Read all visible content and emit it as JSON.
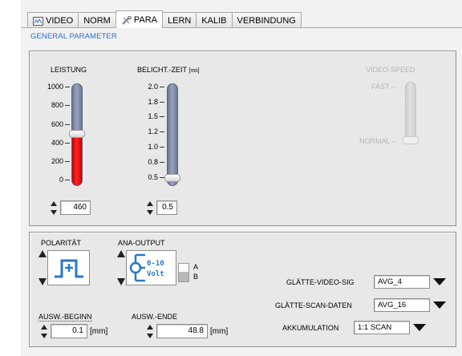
{
  "tabs": [
    {
      "label": "VIDEO",
      "icon": "video-tab-icon",
      "active": false
    },
    {
      "label": "NORM",
      "active": false
    },
    {
      "label": "PARA",
      "icon": "tools-icon",
      "active": true
    },
    {
      "label": "LERN",
      "active": false
    },
    {
      "label": "KALIB",
      "active": false
    },
    {
      "label": "VERBINDUNG",
      "active": false
    }
  ],
  "section_title": "GENERAL PARAMETER",
  "leistung": {
    "label": "LEISTUNG",
    "ticks": [
      "1000",
      "800",
      "600",
      "400",
      "200",
      "0"
    ],
    "value": "460",
    "min": 0,
    "max": 1000,
    "level": 460
  },
  "belicht": {
    "label": "BELICHT.-ZEIT",
    "unit_suffix": "[ms]",
    "ticks": [
      "2.0",
      "1.8",
      "1.5",
      "1.2",
      "1.0",
      "0.8",
      "0.5"
    ],
    "value": "0.5",
    "min": 0.5,
    "max": 2.0,
    "level": 0.5
  },
  "video_speed": {
    "label": "VIDEO-SPEED",
    "fast": "FAST",
    "normal": "NORMAL",
    "setting": "NORMAL"
  },
  "polaritaet": {
    "label": "POLARITÄT",
    "icon": "positive-pulse-icon"
  },
  "ana_output": {
    "label": "ANA-OUTPUT",
    "icon": "voltage-output-icon",
    "icon_text_1": "0-10",
    "icon_text_2": "Volt",
    "switch_a": "A",
    "switch_b": "B",
    "selected": "B"
  },
  "ausw_beginn": {
    "label": "AUSW.-BEGINN",
    "value": "0.1",
    "unit": "[mm]"
  },
  "ausw_ende": {
    "label": "AUSW.-ENDE",
    "value": "48.8",
    "unit": "[mm]"
  },
  "glaette_video": {
    "label": "GLÄTTE-VIDEO-SIG",
    "value": "AVG_4"
  },
  "glaette_scan": {
    "label": "GLÄTTE-SCAN-DATEN",
    "value": "AVG_16"
  },
  "akkumulation": {
    "label": "AKKUMULATION",
    "value": "1:1 SCAN"
  },
  "colors": {
    "accent": "#2a6fc9",
    "slider_fill": "#e01010",
    "track": "#7d86a3"
  }
}
